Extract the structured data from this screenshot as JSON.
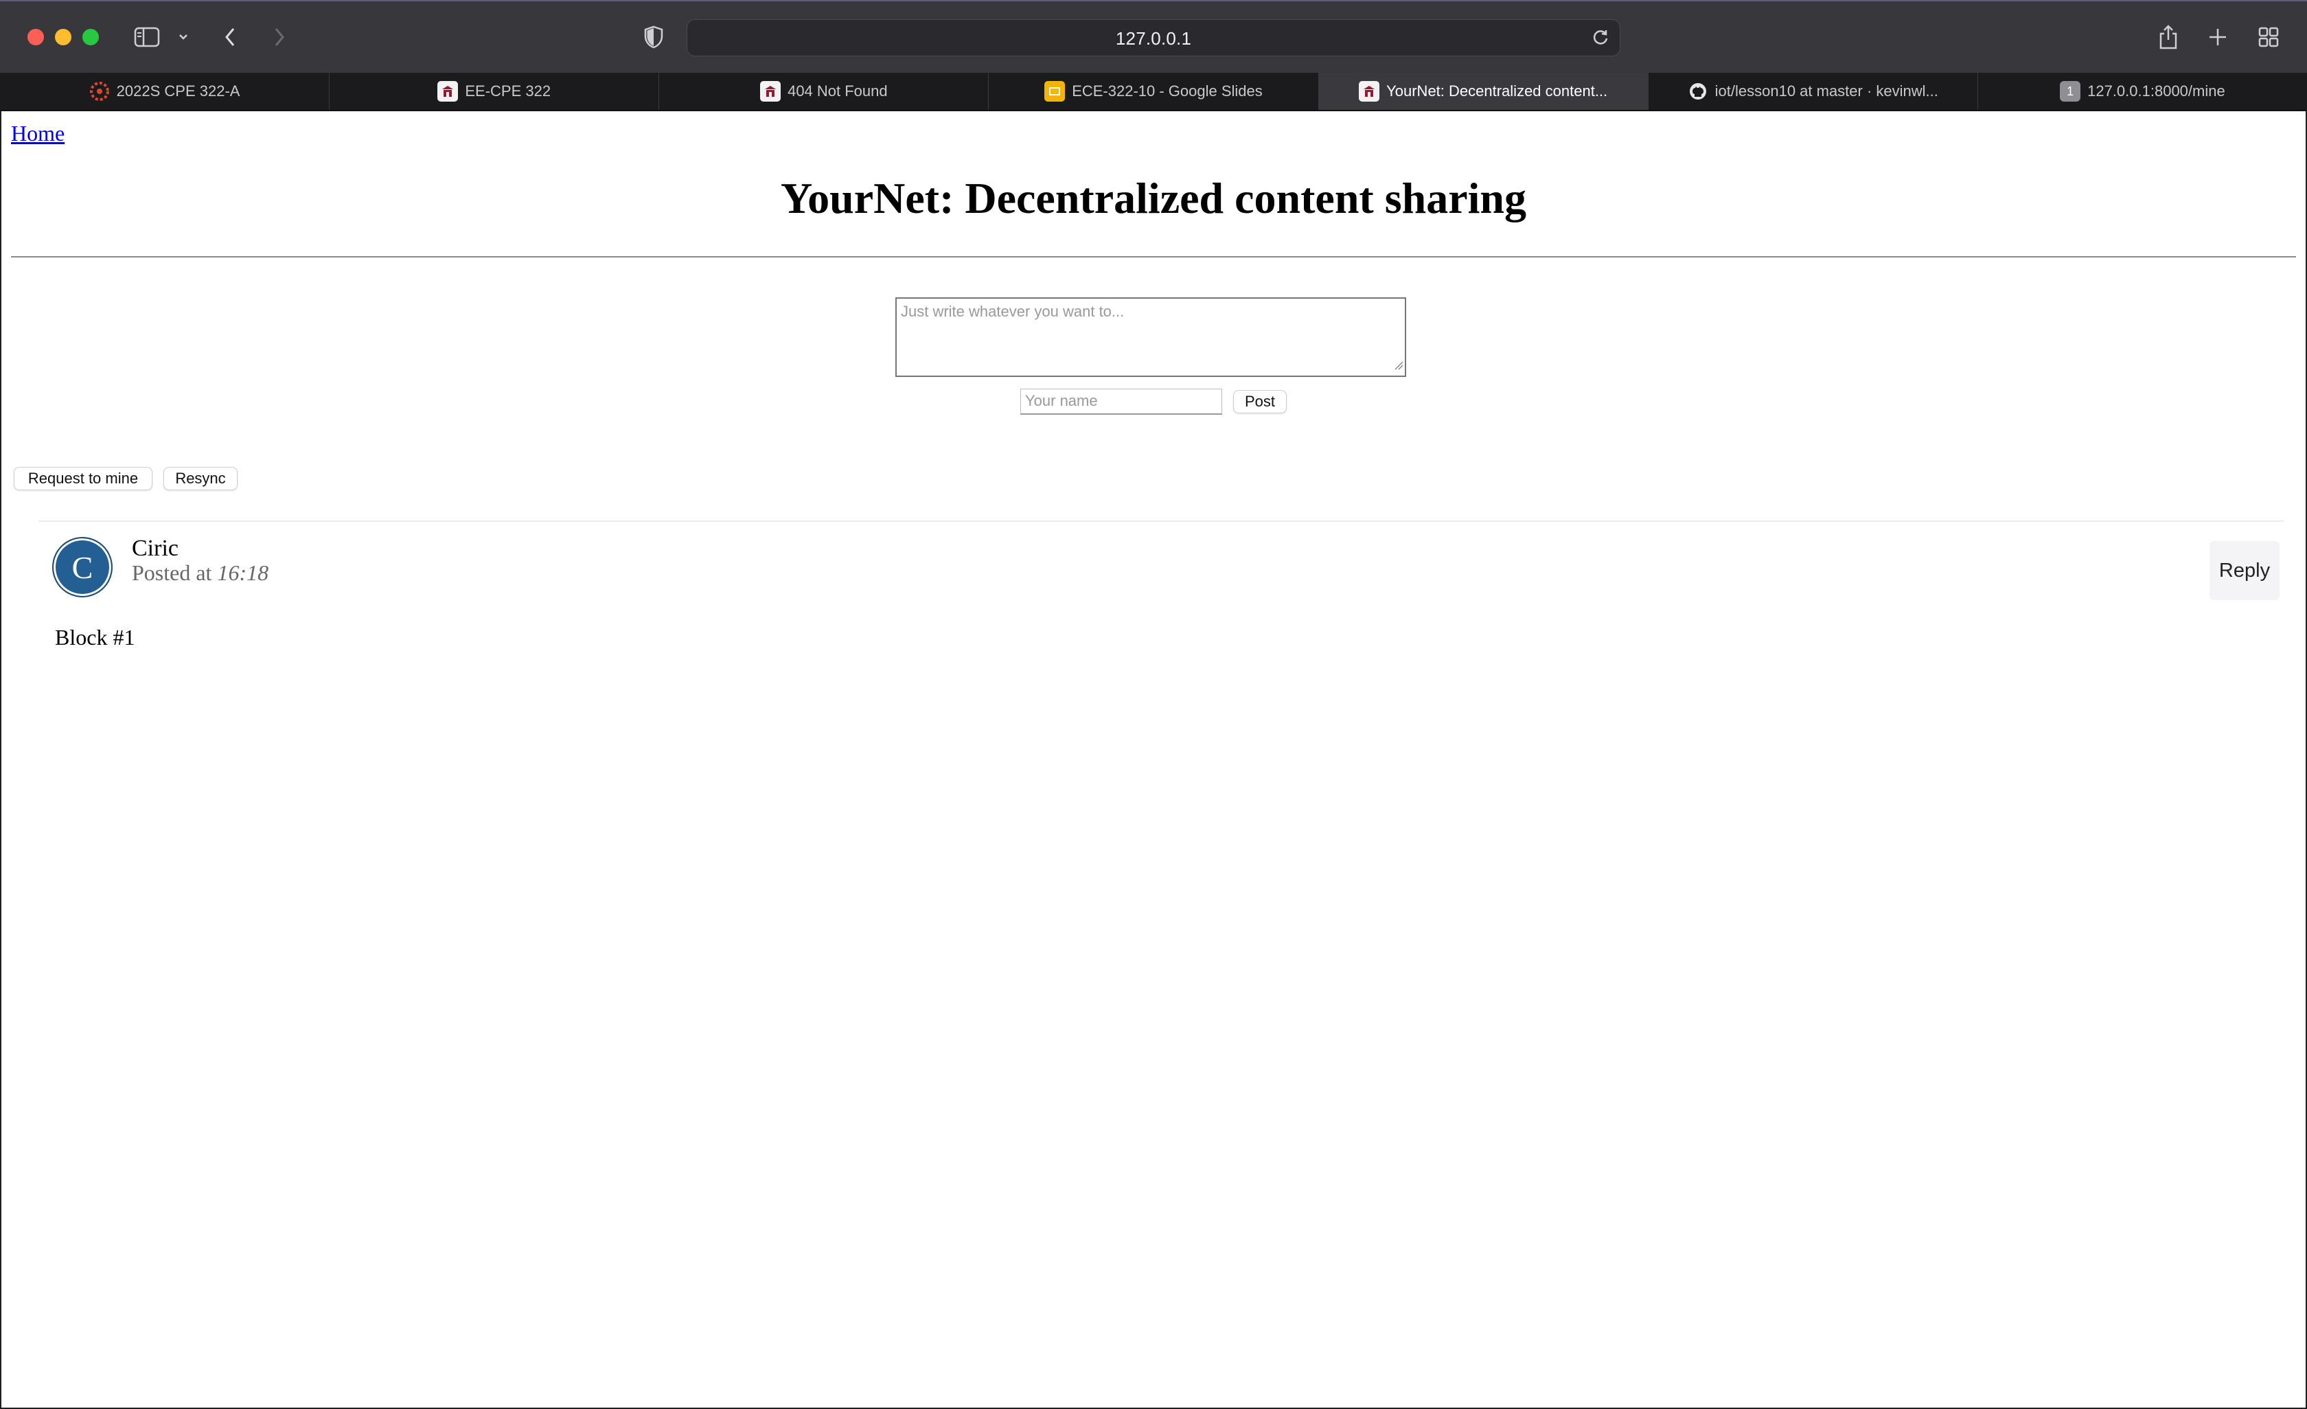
{
  "browser": {
    "url": "127.0.0.1",
    "tabs": [
      {
        "label": "2022S CPE 322-A",
        "icon": "canvas-icon",
        "active": false
      },
      {
        "label": "EE-CPE 322",
        "icon": "stevens-icon",
        "active": false
      },
      {
        "label": "404 Not Found",
        "icon": "stevens-icon",
        "active": false
      },
      {
        "label": "ECE-322-10 - Google Slides",
        "icon": "google-slides-icon",
        "active": false
      },
      {
        "label": "YourNet: Decentralized content...",
        "icon": "stevens-icon",
        "active": true
      },
      {
        "label": "iot/lesson10 at master · kevinwl...",
        "icon": "github-icon",
        "active": false
      },
      {
        "label": "127.0.0.1:8000/mine",
        "icon": "number-badge-icon",
        "badge": "1",
        "active": false
      }
    ]
  },
  "page": {
    "home_link": "Home",
    "title": "YourNet: Decentralized content sharing",
    "compose": {
      "content_placeholder": "Just write whatever you want to...",
      "name_placeholder": "Your name",
      "post_label": "Post"
    },
    "actions": {
      "request_label": "Request to mine",
      "resync_label": "Resync"
    },
    "posts": [
      {
        "avatar_letter": "C",
        "author": "Ciric",
        "posted_prefix": "Posted at",
        "time": "16:18",
        "reply_label": "Reply",
        "content": "Block #1"
      }
    ]
  },
  "colors": {
    "avatar": "#235f92",
    "link": "#0000ee",
    "chrome": "#38373c"
  }
}
